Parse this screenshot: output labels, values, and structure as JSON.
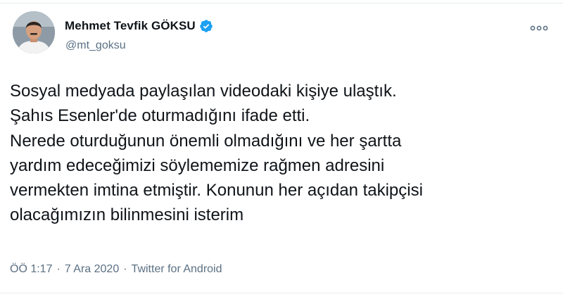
{
  "author": {
    "display_name": "Mehmet Tevfik GÖKSU",
    "handle": "@mt_goksu",
    "verified": true
  },
  "tweet": {
    "lines": [
      "Sosyal medyada paylaşılan videodaki kişiye ulaştık.",
      "Şahıs Esenler'de oturmadığını ifade etti.",
      "Nerede oturduğunun önemli olmadığını ve her şartta",
      "yardım edeceğimizi söylememize rağmen adresini",
      "vermekten imtina etmiştir. Konunun her açıdan takipçisi",
      "olacağımızın bilinmesini isterim"
    ]
  },
  "meta": {
    "time": "ÖÖ 1:17",
    "separator": "·",
    "date": "7 Ara 2020",
    "source": "Twitter for Android"
  },
  "colors": {
    "text": "#0f1419",
    "secondary": "#5b7083",
    "verified": "#1da1f2",
    "border": "#e6ecf0"
  },
  "icons": {
    "verified": "verified-badge-icon",
    "more": "more-options-icon"
  }
}
